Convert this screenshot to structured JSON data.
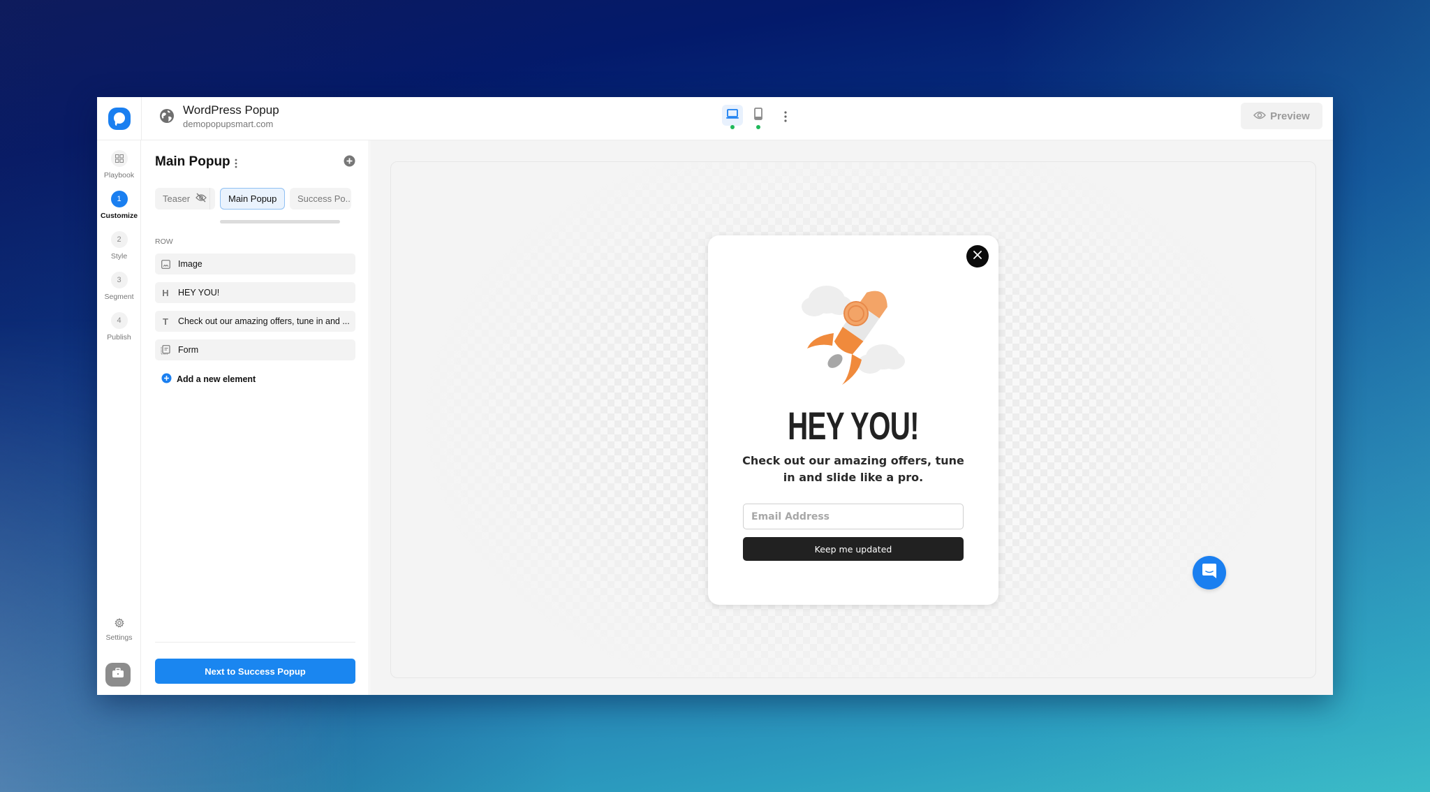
{
  "app": {
    "site_title": "WordPress Popup",
    "site_domain": "demopopupsmart.com",
    "brand_color": "#1a7ff0"
  },
  "topbar": {
    "devices": [
      {
        "name": "desktop",
        "icon": "laptop-icon",
        "active": true,
        "status": "online"
      },
      {
        "name": "mobile",
        "icon": "mobile-icon",
        "active": false,
        "status": "online"
      }
    ],
    "more_icon": "kebab-icon",
    "preview_label": "Preview",
    "preview_icon": "eye-icon"
  },
  "rail": {
    "items": [
      {
        "label": "Playbook",
        "badge": "",
        "icon": "grid-icon",
        "active": false
      },
      {
        "label": "Customize",
        "badge": "1",
        "active": true
      },
      {
        "label": "Style",
        "badge": "2",
        "active": false
      },
      {
        "label": "Segment",
        "badge": "3",
        "active": false
      },
      {
        "label": "Publish",
        "badge": "4",
        "active": false
      }
    ],
    "settings_label": "Settings",
    "bottom_icon": "briefcase-icon"
  },
  "panel": {
    "title": "Main Popup",
    "tabs": [
      {
        "label": "Teaser",
        "icon": "eye-off-icon",
        "active": false
      },
      {
        "label": "Main Popup",
        "active": true
      },
      {
        "label": "Success Po...",
        "active": false
      }
    ],
    "section_label": "ROW",
    "elements": [
      {
        "label": "Image",
        "icon": "image-icon",
        "glyph": ""
      },
      {
        "label": "HEY YOU!",
        "icon": "heading-icon",
        "glyph": "H"
      },
      {
        "label": "Check out our amazing offers, tune in and ...",
        "icon": "text-icon",
        "glyph": "T"
      },
      {
        "label": "Form",
        "icon": "form-icon",
        "glyph": ""
      }
    ],
    "add_element_label": "Add a new element",
    "next_button_label": "Next to Success Popup"
  },
  "popup": {
    "image_alt": "rocket",
    "heading": "HEY YOU!",
    "text": "Check out our amazing offers, tune in and slide like a pro.",
    "email_placeholder": "Email Address",
    "email_value": "",
    "submit_label": "Keep me updated"
  }
}
